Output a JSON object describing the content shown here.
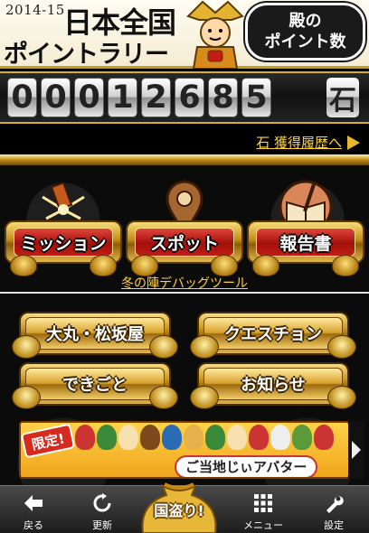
{
  "header": {
    "season": "2014-15",
    "title_line1": "日本全国",
    "title_line2": "ポイントラリー",
    "bubble_line1": "殿の",
    "bubble_line2": "ポイント数"
  },
  "points": {
    "digits": [
      "0",
      "0",
      "0",
      "1",
      "2",
      "6",
      "8",
      "5"
    ],
    "unit": "石"
  },
  "history_link": "石 獲得履歴へ",
  "main_menu": [
    {
      "label": "ミッション",
      "icon": "firework-icon"
    },
    {
      "label": "スポット",
      "icon": "map-pin-icon"
    },
    {
      "label": "報告書",
      "icon": "book-brush-icon"
    }
  ],
  "debug_link": "冬の陣デバッグツール",
  "sub_buttons": {
    "daimaru": "大丸・松坂屋",
    "question": "クエスチョン",
    "dekigoto": "できごと",
    "oshirase": "お知らせ"
  },
  "banner": {
    "badge": "限定!",
    "title": "ご当地じぃアバター"
  },
  "toolbar": {
    "back": "戻る",
    "refresh": "更新",
    "center": "国盗り!",
    "menu": "メニュー",
    "settings": "設定"
  },
  "colors": {
    "gold": "#d7a22c",
    "red": "#a3100a",
    "link_yellow": "#ffd23c"
  }
}
